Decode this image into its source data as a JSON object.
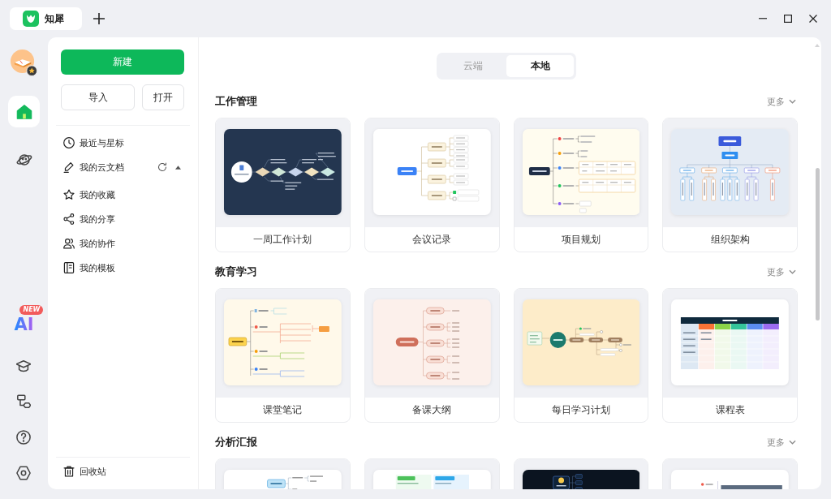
{
  "tabs": [
    {
      "label": "知犀",
      "selected": true
    }
  ],
  "rail": {
    "items": [
      {
        "selected": true
      },
      {
        "selected": false
      }
    ],
    "ai": {
      "label": "AI",
      "badge": "NEW"
    }
  },
  "sidebar": {
    "new_button": "新建",
    "buttons": [
      "导入",
      "打开"
    ],
    "nav": [
      {
        "label": "最近与星标",
        "kind": "link"
      },
      {
        "label": "我的云文档",
        "kind": "folder",
        "expanded": true
      },
      {
        "label": "我的收藏",
        "kind": "link"
      },
      {
        "label": "我的分享",
        "kind": "link"
      },
      {
        "label": "我的协作",
        "kind": "link"
      },
      {
        "label": "我的模板",
        "kind": "link"
      }
    ],
    "trash": "回收站"
  },
  "source_switch": [
    {
      "label": "云端",
      "selected": false
    },
    {
      "label": "本地",
      "selected": true
    }
  ],
  "sections": [
    {
      "title": "工作管理",
      "more": "更多",
      "templates": [
        {
          "title": "一周工作计划",
          "kind": "flow-dark"
        },
        {
          "title": "会议记录",
          "kind": "meeting"
        },
        {
          "title": "项目规划",
          "kind": "project"
        },
        {
          "title": "组织架构",
          "kind": "org"
        }
      ]
    },
    {
      "title": "教育学习",
      "more": "更多",
      "templates": [
        {
          "title": "课堂笔记",
          "kind": "notes"
        },
        {
          "title": "备课大纲",
          "kind": "outline"
        },
        {
          "title": "每日学习计划",
          "kind": "daily"
        },
        {
          "title": "课程表",
          "kind": "timetable"
        }
      ]
    },
    {
      "title": "分析汇报",
      "more": "更多",
      "templates": [
        {
          "kind": "mindmap-light"
        },
        {
          "kind": "columns"
        },
        {
          "kind": "dark-mindmap"
        },
        {
          "kind": "table-gray"
        }
      ]
    }
  ]
}
